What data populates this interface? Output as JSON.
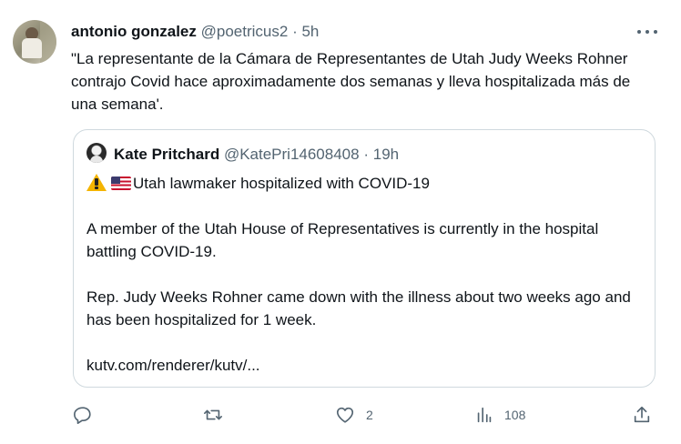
{
  "tweet": {
    "author_name": "antonio gonzalez",
    "author_handle": "@poetricus2",
    "separator": "·",
    "time": "5h",
    "text": "\"La representante de la Cámara de Representantes de Utah Judy Weeks Rohner contrajo Covid hace aproximadamente dos semanas y lleva hospitalizada más de una semana'.",
    "more_icon": "ellipsis-icon"
  },
  "quote": {
    "author_name": "Kate Pritchard",
    "author_handle": "@KatePri14608408",
    "separator": "·",
    "time": "19h",
    "headline": "Utah lawmaker hospitalized with COVID-19",
    "paragraph1": "A member of the Utah House of Representatives is currently in the hospital battling COVID-19.",
    "paragraph2": "Rep. Judy Weeks Rohner came down with the illness about two weeks ago and has been hospitalized for 1 week.",
    "link": "kutv.com/renderer/kutv/..."
  },
  "actions": {
    "reply_icon": "reply-icon",
    "retweet_icon": "retweet-icon",
    "like_icon": "heart-icon",
    "like_count": "2",
    "views_icon": "analytics-icon",
    "views_count": "108",
    "share_icon": "share-icon"
  },
  "colors": {
    "text": "#0f1419",
    "secondary": "#536471",
    "border": "#cfd9de"
  }
}
